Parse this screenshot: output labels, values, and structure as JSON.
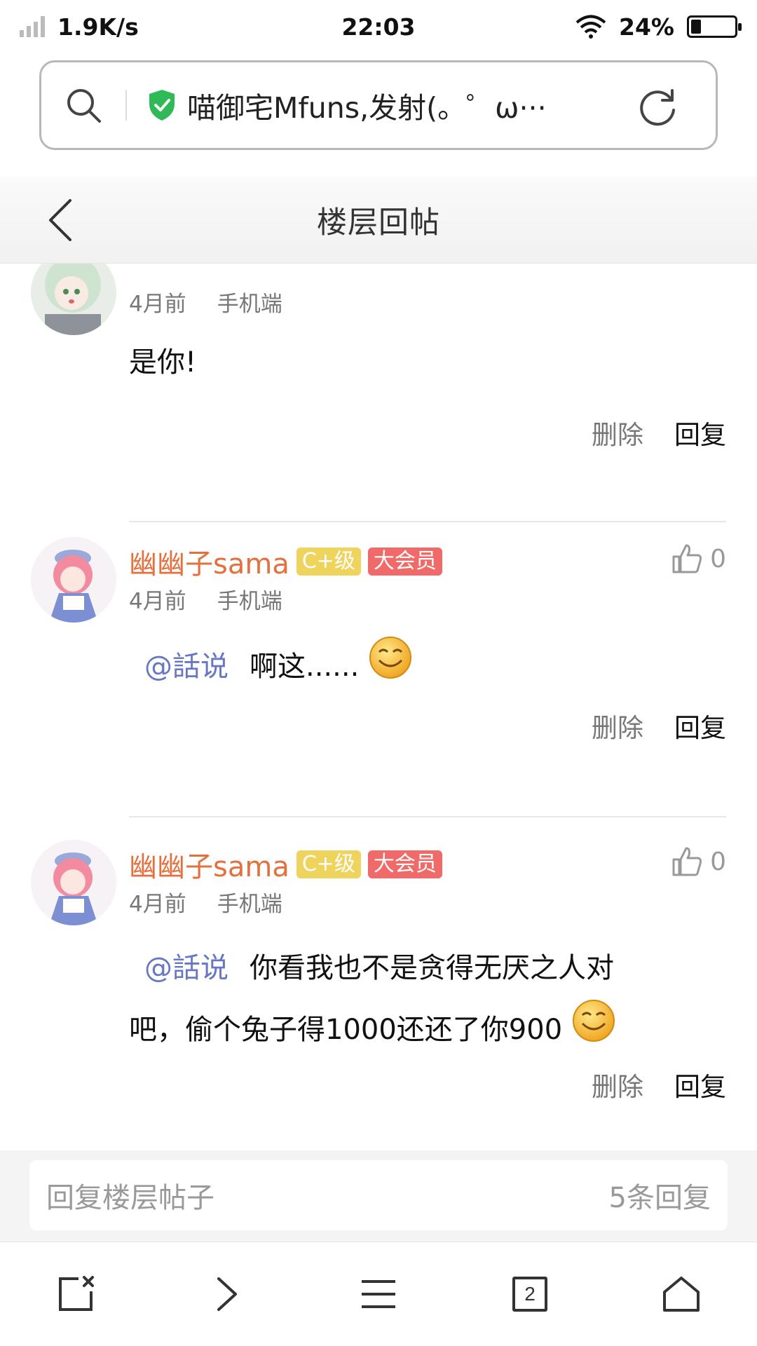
{
  "status_bar": {
    "net_speed": "1.9K/s",
    "time": "22:03",
    "battery": "24%",
    "battery_level": 0.24
  },
  "url_bar": {
    "text": "喵御宅Mfuns,发射(。゜ω···"
  },
  "header": {
    "title": "楼层回帖"
  },
  "posts": [
    {
      "time": "4月前",
      "device": "手机端",
      "text": "是你!",
      "delete_label": "删除",
      "reply_label": "回复"
    },
    {
      "username": "幽幽子sama",
      "level_badge": "C+级",
      "vip_badge": "大会员",
      "likes": "0",
      "time": "4月前",
      "device": "手机端",
      "mention": "@話说",
      "text": "啊这......",
      "delete_label": "删除",
      "reply_label": "回复"
    },
    {
      "username": "幽幽子sama",
      "level_badge": "C+级",
      "vip_badge": "大会员",
      "likes": "0",
      "time": "4月前",
      "device": "手机端",
      "mention": "@話说",
      "text_line1": "你看我也不是贪得无厌之人对",
      "text_line2": "吧，偷个兔子得1000还还了你900",
      "delete_label": "删除",
      "reply_label": "回复"
    }
  ],
  "reply_bar": {
    "placeholder": "回复楼层帖子",
    "count": "5条回复"
  },
  "bottom_nav": {
    "tab_count": "2"
  },
  "colors": {
    "username": "#e5703e",
    "mention": "#6777c4",
    "level_badge": "#eed35c",
    "vip_badge": "#f06a6a"
  }
}
